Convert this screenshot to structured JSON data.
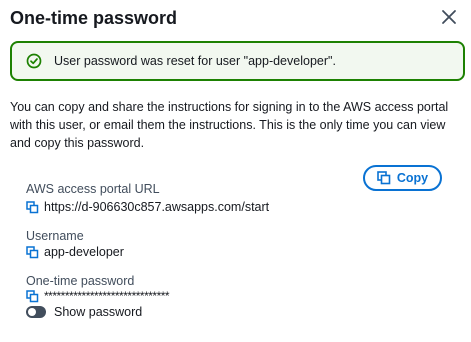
{
  "modal": {
    "title": "One-time password",
    "close_icon": "close-icon"
  },
  "alert": {
    "icon": "check-circle-icon",
    "message": "User password was reset for user \"app-developer\".",
    "color": "#1d8102"
  },
  "description": "You can copy and share the instructions for signing in to the AWS access portal with this user, or email them the instructions. This is the only time you can view and copy this password.",
  "copy_button": {
    "label": "Copy",
    "icon": "copy-icon",
    "color": "#0972d3"
  },
  "fields": {
    "portal_url": {
      "label": "AWS access portal URL",
      "value": "https://d-906630c857.awsapps.com/start",
      "icon": "copy-icon"
    },
    "username": {
      "label": "Username",
      "value": "app-developer",
      "icon": "copy-icon"
    },
    "password": {
      "label": "One-time password",
      "value": "******************************",
      "icon": "copy-icon"
    }
  },
  "show_password": {
    "label": "Show password",
    "checked": false
  }
}
